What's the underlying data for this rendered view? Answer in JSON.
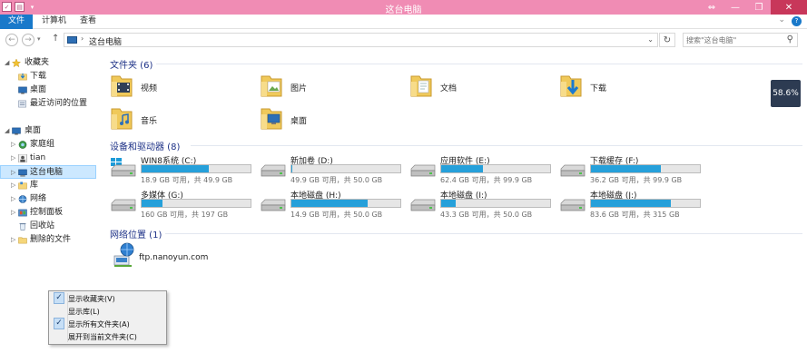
{
  "window": {
    "title": "这台电脑",
    "controls": {
      "restore": "⇔",
      "minimize": "—",
      "maximize": "❐",
      "close": "✕"
    }
  },
  "ribbon": {
    "file_tab": "文件",
    "tabs": [
      "计算机",
      "查看"
    ],
    "help": "?",
    "expand": "⌄"
  },
  "address": {
    "path": "这台电脑",
    "search_placeholder": "搜索\"这台电脑\""
  },
  "nav_pane": {
    "items": [
      {
        "label": "收藏夹",
        "icon": "star-icon"
      },
      {
        "label": "下载",
        "icon": "download-folder-icon"
      },
      {
        "label": "桌面",
        "icon": "desktop-icon"
      },
      {
        "label": "最近访问的位置",
        "icon": "recent-places-icon"
      },
      {
        "label": "桌面",
        "icon": "desktop-icon"
      },
      {
        "label": "家庭组",
        "icon": "homegroup-icon"
      },
      {
        "label": "tian",
        "icon": "user-icon"
      },
      {
        "label": "这台电脑",
        "icon": "computer-icon"
      },
      {
        "label": "库",
        "icon": "library-icon"
      },
      {
        "label": "网络",
        "icon": "network-icon"
      },
      {
        "label": "控制面板",
        "icon": "control-panel-icon"
      },
      {
        "label": "回收站",
        "icon": "recycle-bin-icon"
      },
      {
        "label": "删除的文件",
        "icon": "folder-icon"
      }
    ]
  },
  "folders": {
    "header": "文件夹 (6)",
    "items": [
      {
        "label": "视频",
        "icon": "videos-folder-icon"
      },
      {
        "label": "图片",
        "icon": "pictures-folder-icon"
      },
      {
        "label": "文档",
        "icon": "documents-folder-icon"
      },
      {
        "label": "下载",
        "icon": "downloads-folder-icon"
      },
      {
        "label": "音乐",
        "icon": "music-folder-icon"
      },
      {
        "label": "桌面",
        "icon": "desktop-folder-icon"
      }
    ]
  },
  "drives": {
    "header": "设备和驱动器 (8)",
    "items": [
      {
        "label": "WIN8系统 (C:)",
        "info": "18.9 GB 可用，共 49.9 GB",
        "used": 0.62,
        "system": true
      },
      {
        "label": "新加卷 (D:)",
        "info": "49.9 GB 可用，共 50.0 GB",
        "used": 0.01,
        "system": false
      },
      {
        "label": "应用软件 (E:)",
        "info": "62.4 GB 可用，共 99.9 GB",
        "used": 0.38,
        "system": false
      },
      {
        "label": "下载缓存 (F:)",
        "info": "36.2 GB 可用，共 99.9 GB",
        "used": 0.64,
        "system": false
      },
      {
        "label": "多媒体 (G:)",
        "info": "160 GB 可用，共 197 GB",
        "used": 0.19,
        "system": false
      },
      {
        "label": "本地磁盘 (H:)",
        "info": "14.9 GB 可用，共 50.0 GB",
        "used": 0.7,
        "system": false
      },
      {
        "label": "本地磁盘 (I:)",
        "info": "43.3 GB 可用，共 50.0 GB",
        "used": 0.13,
        "system": false
      },
      {
        "label": "本地磁盘 (J:)",
        "info": "83.6 GB 可用，共 315 GB",
        "used": 0.73,
        "system": false
      }
    ]
  },
  "network": {
    "header": "网络位置 (1)",
    "items": [
      {
        "label": "ftp.nanoyun.com",
        "icon": "network-location-icon"
      }
    ]
  },
  "badge": "58.6%",
  "context_menu": {
    "items": [
      {
        "label": "显示收藏夹(V)",
        "checked": true
      },
      {
        "label": "显示库(L)",
        "checked": false
      },
      {
        "label": "显示所有文件夹(A)",
        "checked": true
      },
      {
        "label": "展开到当前文件夹(C)",
        "checked": false
      }
    ]
  },
  "colors": {
    "titlebar": "#f08cb4",
    "file_tab": "#1979ca",
    "drive_fill": "#26a0da",
    "group_header": "#1e3287"
  }
}
